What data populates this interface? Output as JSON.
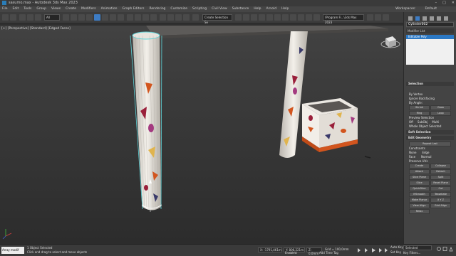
{
  "window": {
    "title": "sasumo.max - Autodesk 3ds Max 2023",
    "controls": [
      "–",
      "□",
      "✕"
    ]
  },
  "menubar": {
    "items": [
      "File",
      "Edit",
      "Tools",
      "Group",
      "Views",
      "Create",
      "Modifiers",
      "Animation",
      "Graph Editors",
      "Rendering",
      "Customize",
      "Scripting",
      "Civil View",
      "Substance",
      "Help",
      "Arnold",
      "Help"
    ],
    "right_items": [
      "Workspaces:",
      "Default"
    ]
  },
  "toolbar": {
    "view_dropdown": "All",
    "selection_set": "Create Selection Se",
    "project": "\\Program Fi...\\3ds Max 2023"
  },
  "viewport": {
    "label": "[+] [Perspective] [Standard] [Edged Faces]"
  },
  "command_panel": {
    "object_name": "Cylinder002",
    "modifier_list": "Modifier List",
    "stack_item": "Editable Poly",
    "selection": {
      "title": "Selection",
      "by_vertex": "By Vertex",
      "ignore_backfacing": "Ignore Backfacing",
      "by_angle": "By Angle:",
      "shrink": "Shrink",
      "grow": "Grow",
      "ring": "Ring",
      "loop": "Loop",
      "preview_selection": "Preview Selection",
      "preview_opts": [
        "Off",
        "SubObj",
        "Multi"
      ],
      "whole_object": "Whole Object Selected"
    },
    "soft_selection": "Soft Selection",
    "edit_geometry": {
      "title": "Edit Geometry",
      "repeat_last": "Repeat Last",
      "constraints": "Constraints",
      "constraint_opts": [
        "None",
        "Edge",
        "Face",
        "Normal"
      ],
      "preserve_uvs": "Preserve UVs",
      "buttons": [
        "Create",
        "Collapse",
        "Attach",
        "Detach",
        "Slice Plane",
        "Split",
        "Slice",
        "Reset Plane",
        "QuickSlice",
        "Cut",
        "MSmooth",
        "Tessellate",
        "Make Planar",
        "X Y Z",
        "View Align",
        "Grid Align",
        "Relax"
      ]
    }
  },
  "statusbar": {
    "maxscript": "Array modif",
    "line1": "1 Object Selected",
    "line2": "Click and drag to select and move objects",
    "x": "X: -1791,461m",
    "y": "Y: 806,221m",
    "z": "Z: 0,0mm",
    "grid": "Grid = 100,0mm",
    "enabled": "Enabled:",
    "add_time_tag": "Add Time Tag",
    "auto_key": "Auto Key",
    "set_key": "Set Key",
    "selected": "Selected",
    "key_filters": "Key Filters..."
  },
  "colors": {
    "selection_blue": "#3d7cc4",
    "stack_highlight": "#2b78c4",
    "terrazzo_orange": "#d2551e",
    "terrazzo_red": "#9a1f3a",
    "selection_cyan": "#5fd3d8"
  }
}
